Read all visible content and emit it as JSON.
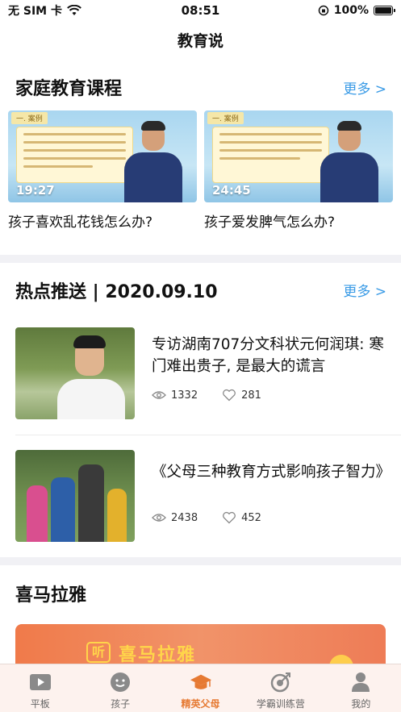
{
  "status_bar": {
    "carrier": "无 SIM 卡",
    "time": "08:51",
    "battery": "100%",
    "battery_level": 1.0
  },
  "nav": {
    "title": "教育说"
  },
  "courses_section": {
    "title": "家庭教育课程",
    "more_label": "更多 >",
    "items": [
      {
        "tag": "一. 案例",
        "duration": "19:27",
        "caption": "孩子喜欢乱花钱怎么办?"
      },
      {
        "tag": "一. 案例",
        "duration": "24:45",
        "caption": "孩子爱发脾气怎么办?"
      }
    ]
  },
  "hot_section": {
    "title": "热点推送 | 2020.09.10",
    "more_label": "更多 >",
    "items": [
      {
        "title": "专访湖南707分文科状元何润琪: 寒门难出贵子, 是最大的谎言",
        "views": "1332",
        "likes": "281"
      },
      {
        "title": "《父母三种教育方式影响孩子智力》",
        "views": "2438",
        "likes": "452"
      }
    ]
  },
  "himalaya_section": {
    "title": "喜马拉雅",
    "banner_logo": "听",
    "banner_text": "喜马拉雅"
  },
  "tab_bar": {
    "items": [
      {
        "label": "平板",
        "icon": "play-icon",
        "active": false
      },
      {
        "label": "孩子",
        "icon": "face-icon",
        "active": false
      },
      {
        "label": "精英父母",
        "icon": "graduation-cap-icon",
        "active": true
      },
      {
        "label": "学霸训练营",
        "icon": "target-icon",
        "active": false
      },
      {
        "label": "我的",
        "icon": "person-icon",
        "active": false
      }
    ]
  },
  "colors": {
    "accent": "#e67a33",
    "link": "#3a9be6",
    "banner": "#f07a4a"
  }
}
